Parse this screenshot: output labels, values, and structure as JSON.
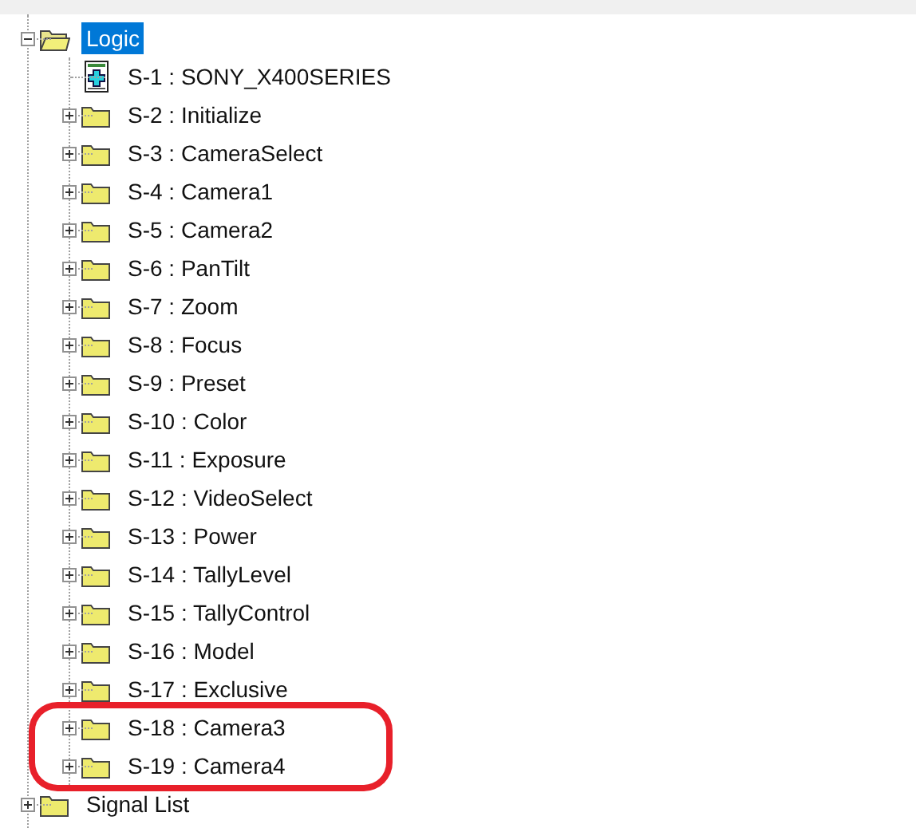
{
  "tree": [
    {
      "kind": "folder",
      "label": "Logic",
      "selected": true,
      "expanded": true,
      "children": [
        {
          "kind": "device",
          "label": "S-1 : SONY_X400SERIES",
          "selected": false,
          "highlighted": false
        },
        {
          "kind": "folder",
          "label": "S-2 : Initialize",
          "selected": false,
          "expanded": false,
          "highlighted": false
        },
        {
          "kind": "folder",
          "label": "S-3 : CameraSelect",
          "selected": false,
          "expanded": false,
          "highlighted": false
        },
        {
          "kind": "folder",
          "label": "S-4 : Camera1",
          "selected": false,
          "expanded": false,
          "highlighted": false
        },
        {
          "kind": "folder",
          "label": "S-5 : Camera2",
          "selected": false,
          "expanded": false,
          "highlighted": false
        },
        {
          "kind": "folder",
          "label": "S-6 : PanTilt",
          "selected": false,
          "expanded": false,
          "highlighted": false
        },
        {
          "kind": "folder",
          "label": "S-7 : Zoom",
          "selected": false,
          "expanded": false,
          "highlighted": false
        },
        {
          "kind": "folder",
          "label": "S-8 : Focus",
          "selected": false,
          "expanded": false,
          "highlighted": false
        },
        {
          "kind": "folder",
          "label": "S-9 : Preset",
          "selected": false,
          "expanded": false,
          "highlighted": false
        },
        {
          "kind": "folder",
          "label": "S-10 : Color",
          "selected": false,
          "expanded": false,
          "highlighted": false
        },
        {
          "kind": "folder",
          "label": "S-11 : Exposure",
          "selected": false,
          "expanded": false,
          "highlighted": false
        },
        {
          "kind": "folder",
          "label": "S-12 : VideoSelect",
          "selected": false,
          "expanded": false,
          "highlighted": false
        },
        {
          "kind": "folder",
          "label": "S-13 : Power",
          "selected": false,
          "expanded": false,
          "highlighted": false
        },
        {
          "kind": "folder",
          "label": "S-14 : TallyLevel",
          "selected": false,
          "expanded": false,
          "highlighted": false
        },
        {
          "kind": "folder",
          "label": "S-15 : TallyControl",
          "selected": false,
          "expanded": false,
          "highlighted": false
        },
        {
          "kind": "folder",
          "label": "S-16 : Model",
          "selected": false,
          "expanded": false,
          "highlighted": false
        },
        {
          "kind": "folder",
          "label": "S-17 : Exclusive",
          "selected": false,
          "expanded": false,
          "highlighted": false
        },
        {
          "kind": "folder",
          "label": "S-18 : Camera3",
          "selected": false,
          "expanded": false,
          "highlighted": true
        },
        {
          "kind": "folder",
          "label": "S-19 : Camera4",
          "selected": false,
          "expanded": false,
          "highlighted": true
        }
      ]
    },
    {
      "kind": "folder",
      "label": "Signal List",
      "selected": false,
      "expanded": false
    }
  ]
}
